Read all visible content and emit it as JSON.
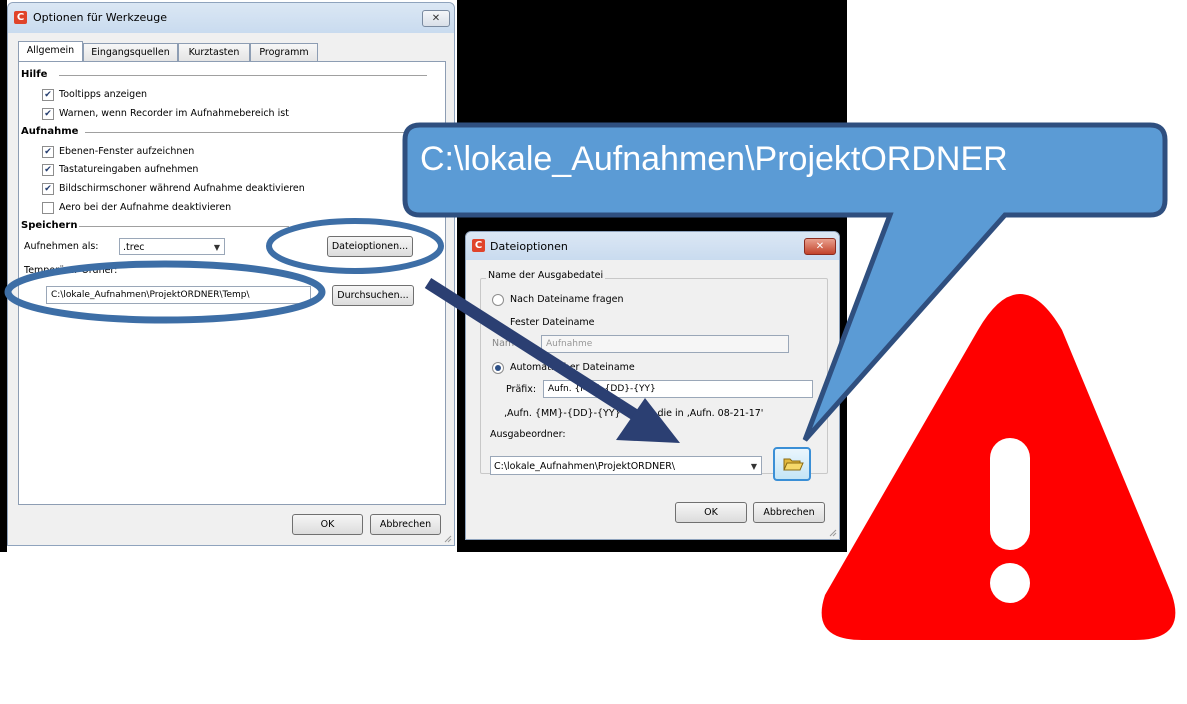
{
  "win1": {
    "title": "Optionen für Werkzeuge",
    "close": "✕",
    "tabs": [
      "Allgemein",
      "Eingangsquellen",
      "Kurztasten",
      "Programm"
    ],
    "sec_hilfe": "Hilfe",
    "cb_tooltips": "Tooltipps anzeigen",
    "cb_warn": "Warnen, wenn Recorder im Aufnahmebereich ist",
    "sec_aufnahme": "Aufnahme",
    "cb_ebenen": "Ebenen-Fenster aufzeichnen",
    "cb_tastatur": "Tastatureingaben aufnehmen",
    "cb_bildschirm": "Bildschirmschoner während Aufnahme deaktivieren",
    "cb_aero": "Aero bei der Aufnahme deaktivieren",
    "sec_speichern": "Speichern",
    "aufnehmen_als_label": "Aufnehmen als:",
    "aufnehmen_als_value": ".trec",
    "dateioptionen_btn": "Dateioptionen...",
    "temp_label": "Temporärer Ordner:",
    "temp_value": "C:\\lokale_Aufnahmen\\ProjektORDNER\\Temp\\",
    "durchsuchen_btn": "Durchsuchen...",
    "ok_btn": "OK",
    "cancel_btn": "Abbrechen",
    "checked": [
      "✔",
      "✔",
      "✔",
      "✔",
      "✔",
      ""
    ]
  },
  "win2": {
    "title": "Dateioptionen",
    "close": "✕",
    "group_title": "Name der Ausgabedatei",
    "radio_fragen": "Nach Dateiname fragen",
    "fester_label": "Fester Dateiname",
    "name_label": "Name:",
    "name_placeholder": "Aufnahme",
    "radio_auto": "Automatischer Dateiname",
    "praefix_label": "Präfix:",
    "praefix_value": "Aufn. {MM}-{DD}-{YY}",
    "preview_text": "‚Aufn. {MM}-{DD}-{YY}' Ergibt die in ‚Aufn. 08-21-17'",
    "ausgabe_label": "Ausgabeordner:",
    "ausgabe_value": "C:\\lokale_Aufnahmen\\ProjektORDNER\\",
    "ok_btn": "OK",
    "cancel_btn": "Abbrechen"
  },
  "callout": {
    "text": "C:\\lokale_Aufnahmen\\ProjektORDNER"
  },
  "colors": {
    "callout_fill": "#5b9bd5",
    "callout_border": "#2f4f7f",
    "arrow": "#2b3f72",
    "warning": "#ff0000"
  },
  "icons": {
    "app": "camtasia-icon",
    "folder": "folder-open-icon",
    "warning": "warning-triangle-icon"
  }
}
